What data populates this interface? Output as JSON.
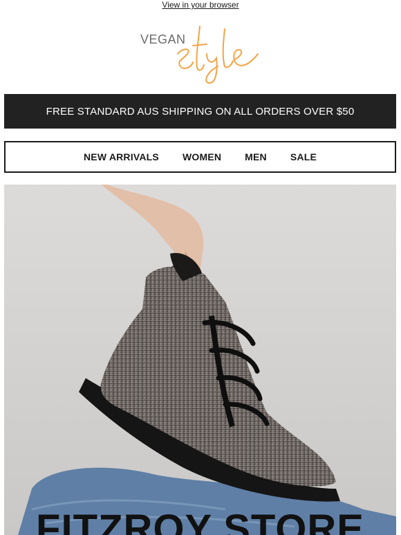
{
  "header": {
    "view_in_browser": "View in your browser"
  },
  "logo": {
    "word1": "VEGAN",
    "word2": "style",
    "accent_color": "#f4a444"
  },
  "shipping_banner": {
    "text": "FREE STANDARD AUS SHIPPING ON ALL ORDERS OVER $50"
  },
  "nav": {
    "items": [
      {
        "label": "NEW ARRIVALS"
      },
      {
        "label": "WOMEN"
      },
      {
        "label": "MEN"
      },
      {
        "label": "SALE"
      }
    ]
  },
  "hero": {
    "title": "FITZROY STORE"
  }
}
